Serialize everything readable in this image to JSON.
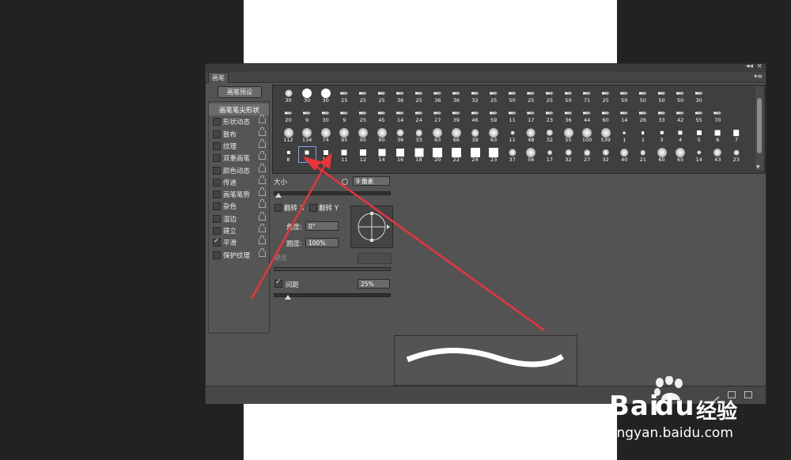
{
  "panel": {
    "tab_label": "画笔",
    "preset_button": "画笔预设",
    "collapse_glyph": "◂◂",
    "close_glyph": "×",
    "menu_glyph": "▾≡"
  },
  "sidebar": {
    "items": [
      {
        "label": "画笔笔尖形状",
        "active": true
      },
      {
        "label": "形状动态",
        "checked": false,
        "lock": true
      },
      {
        "label": "散布",
        "checked": false,
        "lock": true
      },
      {
        "label": "纹理",
        "checked": false,
        "lock": true
      },
      {
        "label": "双重画笔",
        "checked": false,
        "lock": true
      },
      {
        "label": "颜色动态",
        "checked": false,
        "lock": true
      },
      {
        "label": "传递",
        "checked": false,
        "lock": true
      },
      {
        "label": "画笔笔势",
        "checked": false,
        "lock": true
      },
      {
        "label": "杂色",
        "checked": false,
        "lock": true
      },
      {
        "label": "湿边",
        "checked": false,
        "lock": true
      },
      {
        "label": "建立",
        "checked": false,
        "lock": true
      },
      {
        "label": "平滑",
        "checked": true,
        "lock": true
      },
      {
        "label": "保护纹理",
        "checked": false,
        "lock": true
      }
    ]
  },
  "tips": {
    "rows": [
      [
        "30",
        "30",
        "30",
        "25",
        "25",
        "25",
        "36",
        "25",
        "36",
        "36",
        "32",
        "25",
        "50",
        "25",
        "25",
        "50",
        "71",
        "25",
        "50",
        "50",
        "50",
        "50",
        "30"
      ],
      [
        "20",
        "9",
        "30",
        "9",
        "25",
        "45",
        "14",
        "24",
        "27",
        "39",
        "46",
        "59",
        "11",
        "17",
        "23",
        "36",
        "44",
        "60",
        "14",
        "26",
        "33",
        "42",
        "55",
        "70"
      ],
      [
        "112",
        "134",
        "74",
        "95",
        "95",
        "90",
        "36",
        "33",
        "63",
        "66",
        "39",
        "63",
        "11",
        "48",
        "32",
        "55",
        "100",
        "539",
        "1",
        "1",
        "3",
        "4",
        "5",
        "6",
        "7"
      ],
      [
        "8",
        "9",
        "10",
        "11",
        "12",
        "14",
        "16",
        "18",
        "20",
        "22",
        "24",
        "23",
        "37",
        "56",
        "17",
        "32",
        "27",
        "32",
        "40",
        "21",
        "60",
        "65",
        "14",
        "43",
        "23"
      ]
    ],
    "selected": "9"
  },
  "controls": {
    "size_label": "大小",
    "size_value": "9 像素",
    "flip_x_label": "翻转 X",
    "flip_y_label": "翻转 Y",
    "angle_label": "角度:",
    "angle_value": "0°",
    "roundness_label": "圆度:",
    "roundness_value": "100%",
    "hardness_label": "硬度",
    "spacing_label": "间距",
    "spacing_checked": true,
    "spacing_value": "25%"
  },
  "watermark": {
    "brand": "Bai",
    "brand2": "du",
    "product": "经验",
    "url": "jingyan.baidu.com"
  },
  "colors": {
    "panel_bg": "#535353",
    "annotation_arrow": "#e8343a"
  }
}
